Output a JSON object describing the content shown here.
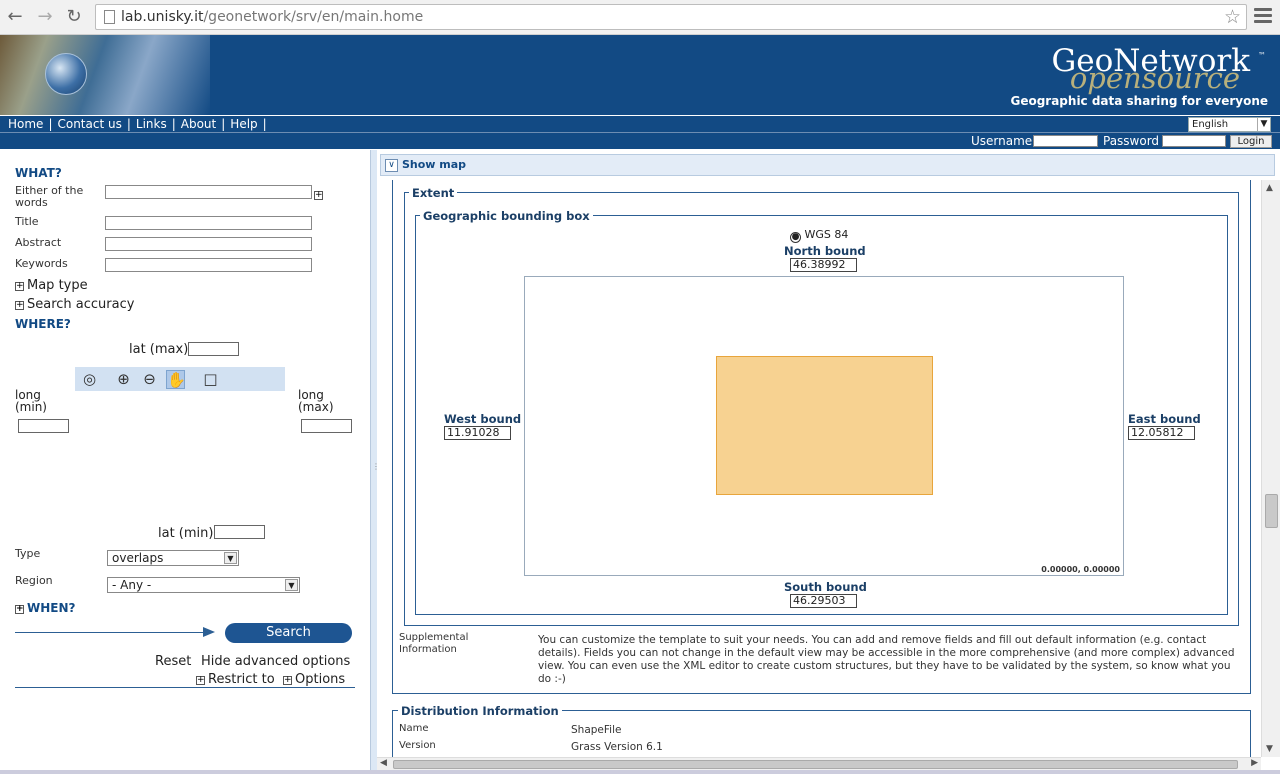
{
  "browser": {
    "url_host": "lab.unisky.it",
    "url_path": "/geonetwork/srv/en/main.home"
  },
  "banner": {
    "logo_main": "GeoNetwork",
    "logo_sub": "opensource",
    "logo_tm": "™",
    "tagline": "Geographic data sharing for everyone"
  },
  "menu": {
    "items": [
      "Home",
      "Contact us",
      "Links",
      "About",
      "Help"
    ],
    "language": "English"
  },
  "login": {
    "username_label": "Username",
    "password_label": "Password",
    "login_button": "Login"
  },
  "search": {
    "what_title": "WHAT?",
    "either_label": "Either of the words",
    "title_label": "Title",
    "abstract_label": "Abstract",
    "keywords_label": "Keywords",
    "map_type": "Map type",
    "search_accuracy": "Search accuracy",
    "where_title": "WHERE?",
    "lat_max_label": "lat (max)",
    "lat_min_label": "lat (min)",
    "long_min_label": "long\n(min)",
    "long_max_label": "long\n(max)",
    "type_label": "Type",
    "type_value": "overlaps",
    "region_label": "Region",
    "region_value": "- Any -",
    "when_title": "WHEN?",
    "search_button": "Search",
    "reset": "Reset",
    "hide_advanced": "Hide advanced options",
    "restrict_to": "Restrict to",
    "options": "Options"
  },
  "main": {
    "show_map": "Show map",
    "extent_legend": "Extent",
    "bbox_legend": "Geographic bounding box",
    "crs": "WGS 84",
    "north_label": "North bound",
    "north_value": "46.38992",
    "west_label": "West bound",
    "west_value": "11.91028",
    "east_label": "East bound",
    "east_value": "12.05812",
    "south_label": "South bound",
    "south_value": "46.29503",
    "cursor_coords": "0.00000, 0.00000",
    "supplemental_label": "Supplemental Information",
    "supplemental_text": "You can customize the template to suit your needs. You can add and remove fields and fill out default information (e.g. contact details). Fields you can not change in the default view may be accessible in the more comprehensive (and more complex) advanced view. You can even use the XML editor to create custom structures, but they have to be validated by the system, so know what you do :-)",
    "distribution_legend": "Distribution Information",
    "name_label": "Name",
    "name_value": "ShapeFile",
    "version_label": "Version",
    "version_value": "Grass Version 6.1"
  },
  "colors": {
    "header_blue": "#124a84",
    "bbox_fill": "#f7d291",
    "search_button": "#1e5592"
  }
}
